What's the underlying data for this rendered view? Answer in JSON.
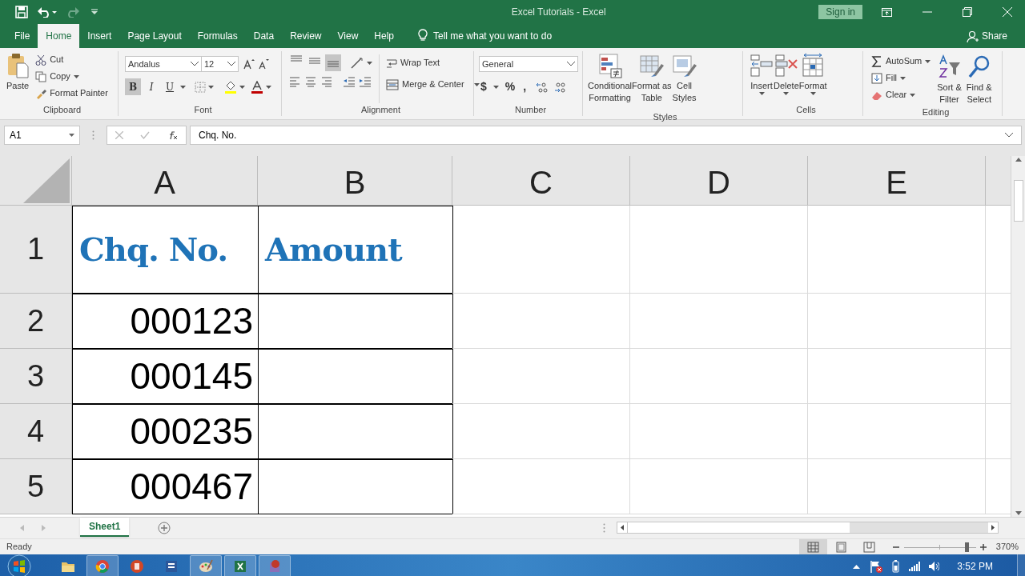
{
  "title_bar": {
    "title": "Excel Tutorials  -  Excel",
    "sign_in": "Sign in"
  },
  "ribbon_tabs": [
    {
      "label": "File",
      "selected": false
    },
    {
      "label": "Home",
      "selected": true
    },
    {
      "label": "Insert",
      "selected": false
    },
    {
      "label": "Page Layout",
      "selected": false
    },
    {
      "label": "Formulas",
      "selected": false
    },
    {
      "label": "Data",
      "selected": false
    },
    {
      "label": "Review",
      "selected": false
    },
    {
      "label": "View",
      "selected": false
    },
    {
      "label": "Help",
      "selected": false
    }
  ],
  "tell_me": "Tell me what you want to do",
  "share": "Share",
  "ribbon_groups": [
    {
      "kind": "clipboard",
      "label": "Clipboard",
      "big": "Paste",
      "items": [
        "Cut",
        "Copy",
        "Format Painter"
      ]
    },
    {
      "kind": "font",
      "label": "Font",
      "font": "Andalus",
      "size": "12",
      "buttons": [
        {
          "label": "B",
          "selected": true
        },
        {
          "label": "I",
          "selected": false
        },
        {
          "label": "U",
          "selected": false
        }
      ]
    },
    {
      "kind": "alignment",
      "label": "Alignment",
      "vertical": [
        {
          "selected": false
        },
        {
          "selected": false
        },
        {
          "selected": true
        }
      ],
      "items": [
        "Wrap Text",
        "Merge & Center"
      ]
    },
    {
      "kind": "number",
      "label": "Number",
      "format": "General",
      "symbols": [
        "$",
        "%",
        ","
      ]
    },
    {
      "kind": "styles",
      "label": "Styles",
      "items": [
        [
          "Conditional",
          "Formatting"
        ],
        [
          "Format as",
          "Table"
        ],
        [
          "Cell",
          "Styles"
        ]
      ]
    },
    {
      "kind": "cells",
      "label": "Cells",
      "items": [
        "Insert",
        "Delete",
        "Format"
      ]
    },
    {
      "kind": "editing",
      "label": "Editing",
      "items": [
        "AutoSum",
        "Fill",
        "Clear"
      ],
      "big": [
        [
          "Sort &",
          "Filter"
        ],
        [
          "Find &",
          "Select"
        ]
      ]
    }
  ],
  "name_box": "A1",
  "formula": "Chq. No.",
  "columns": [
    "A",
    "B",
    "C",
    "D",
    "E"
  ],
  "rows": [
    {
      "number": "1",
      "kind": "heading",
      "cells": [
        "Chq. No.",
        "Amount"
      ]
    },
    {
      "number": "2",
      "kind": "value",
      "cells": [
        "000123"
      ]
    },
    {
      "number": "3",
      "kind": "value",
      "cells": [
        "000145"
      ]
    },
    {
      "number": "4",
      "kind": "value",
      "cells": [
        "000235"
      ]
    },
    {
      "number": "5",
      "kind": "value",
      "cells": [
        "000467"
      ]
    }
  ],
  "sheets": [
    {
      "label": "Sheet1",
      "selected": true
    }
  ],
  "status": "Ready",
  "views": [
    {
      "kind": "normal",
      "selected": true
    },
    {
      "kind": "page_layout",
      "selected": false
    },
    {
      "kind": "page_break",
      "selected": false
    }
  ],
  "zoom": {
    "level": 0.9,
    "reading": "370%"
  },
  "taskbar": {
    "apps": [
      {
        "kind": "folder",
        "open": false
      },
      {
        "kind": "browser",
        "open": true
      },
      {
        "kind": "slides",
        "open": false
      },
      {
        "kind": "document",
        "open": false
      },
      {
        "kind": "paint",
        "open": true
      },
      {
        "kind": "sheet",
        "open": true
      },
      {
        "kind": "recorder",
        "open": true
      }
    ],
    "time": "3:52 PM"
  }
}
